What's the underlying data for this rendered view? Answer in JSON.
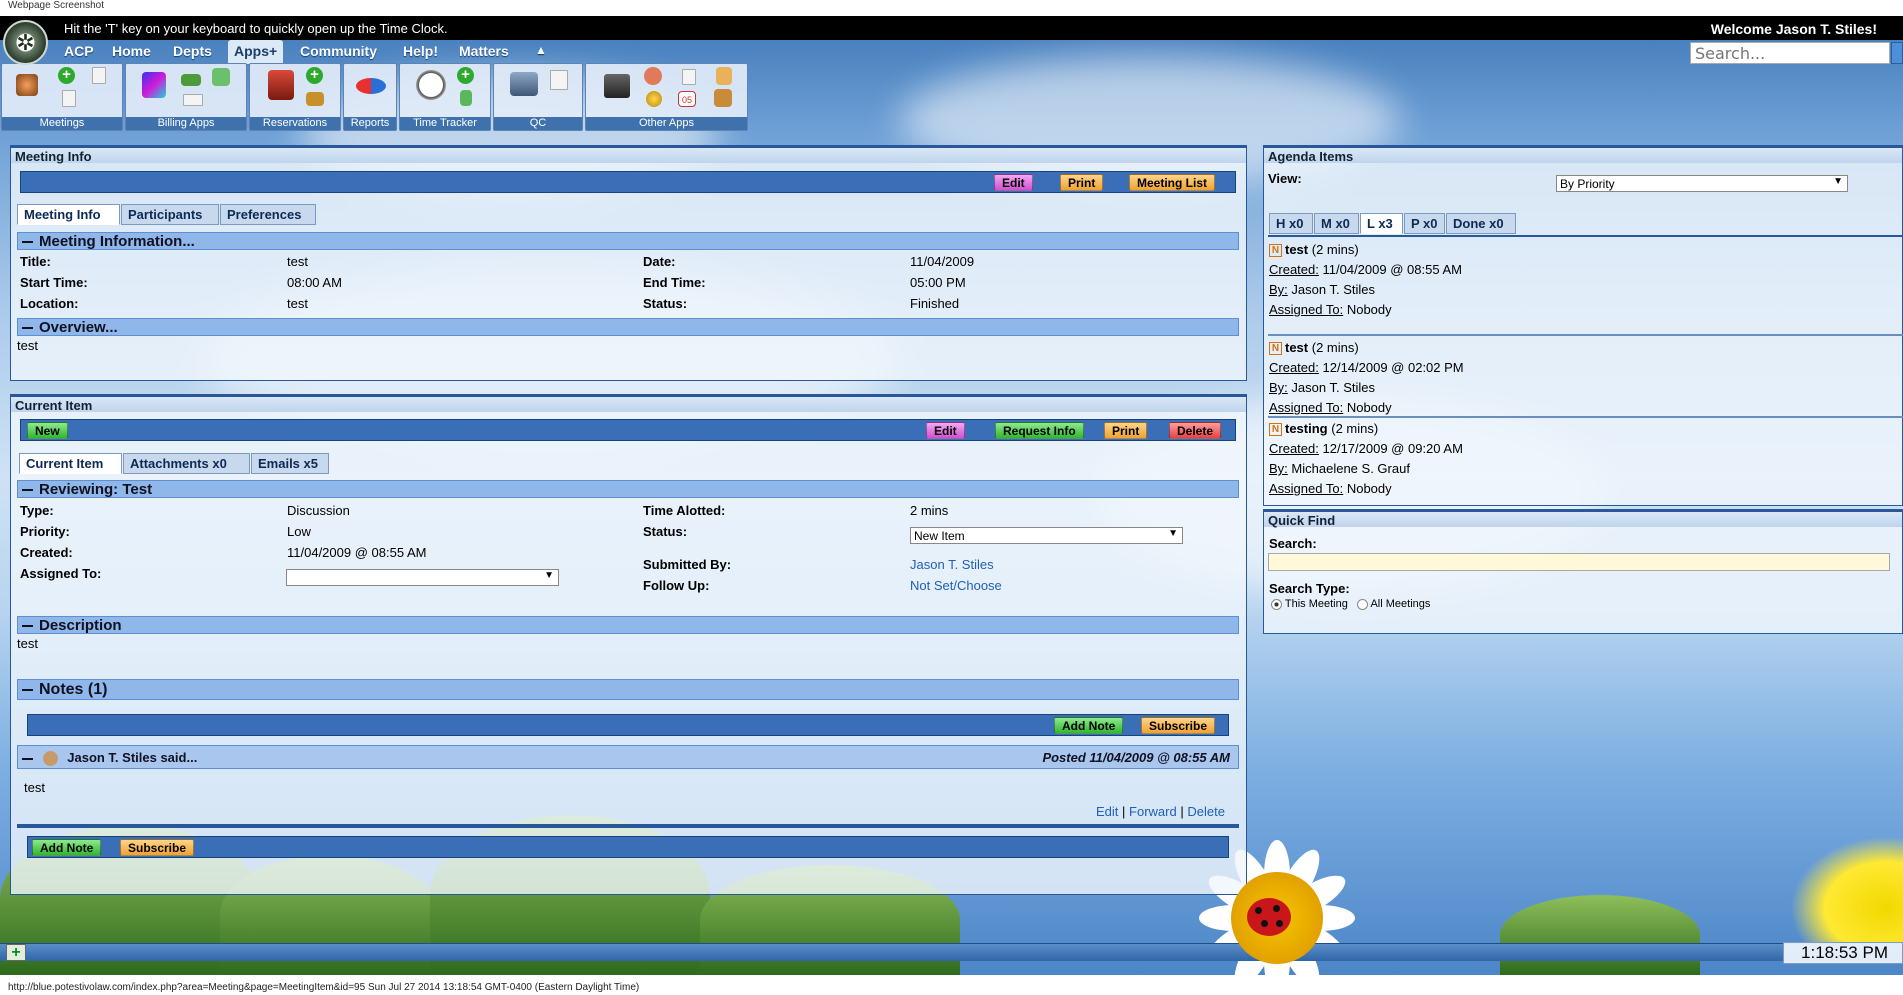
{
  "caption": "Webpage Screenshot",
  "topbar": {
    "hint": "Hit the 'T' key on your keyboard to quickly open up the Time Clock.",
    "welcome": "Welcome Jason T. Stiles!"
  },
  "nav": {
    "items": [
      "ACP",
      "Home",
      "Depts",
      "Apps+",
      "Community",
      "Help!",
      "Matters"
    ],
    "collapse": "▲"
  },
  "search": {
    "placeholder": "Search..."
  },
  "toolbar": {
    "groups": [
      "Meetings",
      "Billing Apps",
      "Reservations",
      "Reports",
      "Time Tracker",
      "QC",
      "Other Apps"
    ],
    "other_apps_date": "05"
  },
  "meeting_info": {
    "panel_title": "Meeting Info",
    "buttons": {
      "edit": "Edit",
      "print": "Print",
      "meeting_list": "Meeting List"
    },
    "tabs": [
      "Meeting Info",
      "Participants",
      "Preferences"
    ],
    "section_title": "Meeting Information...",
    "labels": {
      "title": "Title:",
      "start": "Start Time:",
      "location": "Location:",
      "date": "Date:",
      "end": "End Time:",
      "status": "Status:"
    },
    "values": {
      "title": "test",
      "start": "08:00 AM",
      "location": "test",
      "date": "11/04/2009",
      "end": "05:00 PM",
      "status": "Finished"
    },
    "overview_title": "Overview...",
    "overview_text": "test"
  },
  "current_item": {
    "panel_title": "Current Item",
    "buttons": {
      "new": "New",
      "edit": "Edit",
      "request_info": "Request Info",
      "print": "Print",
      "delete": "Delete"
    },
    "tabs": [
      "Current Item",
      "Attachments x0",
      "Emails x5"
    ],
    "section_title": "Reviewing: Test",
    "labels": {
      "type": "Type:",
      "priority": "Priority:",
      "created": "Created:",
      "assigned": "Assigned To:",
      "time": "Time Alotted:",
      "status": "Status:",
      "submitted": "Submitted By:",
      "follow": "Follow Up:"
    },
    "values": {
      "type": "Discussion",
      "priority": "Low",
      "created": "11/04/2009 @ 08:55 AM",
      "assigned": "",
      "time": "2 mins",
      "status": "New Item",
      "submitted": "Jason T. Stiles",
      "follow": "Not Set/Choose"
    },
    "description_title": "Description",
    "description_text": "test",
    "notes_title": "Notes (1)",
    "note_buttons": {
      "add": "Add Note",
      "subscribe": "Subscribe"
    },
    "note": {
      "author": "Jason T. Stiles said...",
      "posted": "Posted 11/04/2009 @ 08:55 AM",
      "body": "test",
      "actions": {
        "edit": "Edit",
        "sep": "|",
        "forward": "Forward",
        "delete": "Delete"
      }
    }
  },
  "agenda": {
    "panel_title": "Agenda Items",
    "view_label": "View:",
    "view_value": "By Priority",
    "tabs": [
      "H x0",
      "M x0",
      "L x3",
      "P x0",
      "Done x0"
    ],
    "badge": "N",
    "labels": {
      "created": "Created:",
      "by": "By:",
      "assigned": "Assigned To:"
    },
    "items": [
      {
        "title": "test",
        "duration": "(2 mins)",
        "created": "11/04/2009 @ 08:55 AM",
        "by": "Jason T. Stiles",
        "assigned": "Nobody"
      },
      {
        "title": "test",
        "duration": "(2 mins)",
        "created": "12/14/2009 @ 02:02 PM",
        "by": "Jason T. Stiles",
        "assigned": "Nobody"
      },
      {
        "title": "testing",
        "duration": "(2 mins)",
        "created": "12/17/2009 @ 09:20 AM",
        "by": "Michaelene S. Grauf",
        "assigned": "Nobody"
      }
    ]
  },
  "quick_find": {
    "panel_title": "Quick Find",
    "search_label": "Search:",
    "type_label": "Search Type:",
    "options": [
      "This Meeting",
      "All Meetings"
    ],
    "selected": "This Meeting"
  },
  "bottom": {
    "add": "+",
    "clock": "1:18:53 PM"
  },
  "status_url": "http://blue.potestivolaw.com/index.php?area=Meeting&page=MeetingItem&id=95 Sun Jul 27 2014 13:18:54 GMT-0400 (Eastern Daylight Time)"
}
